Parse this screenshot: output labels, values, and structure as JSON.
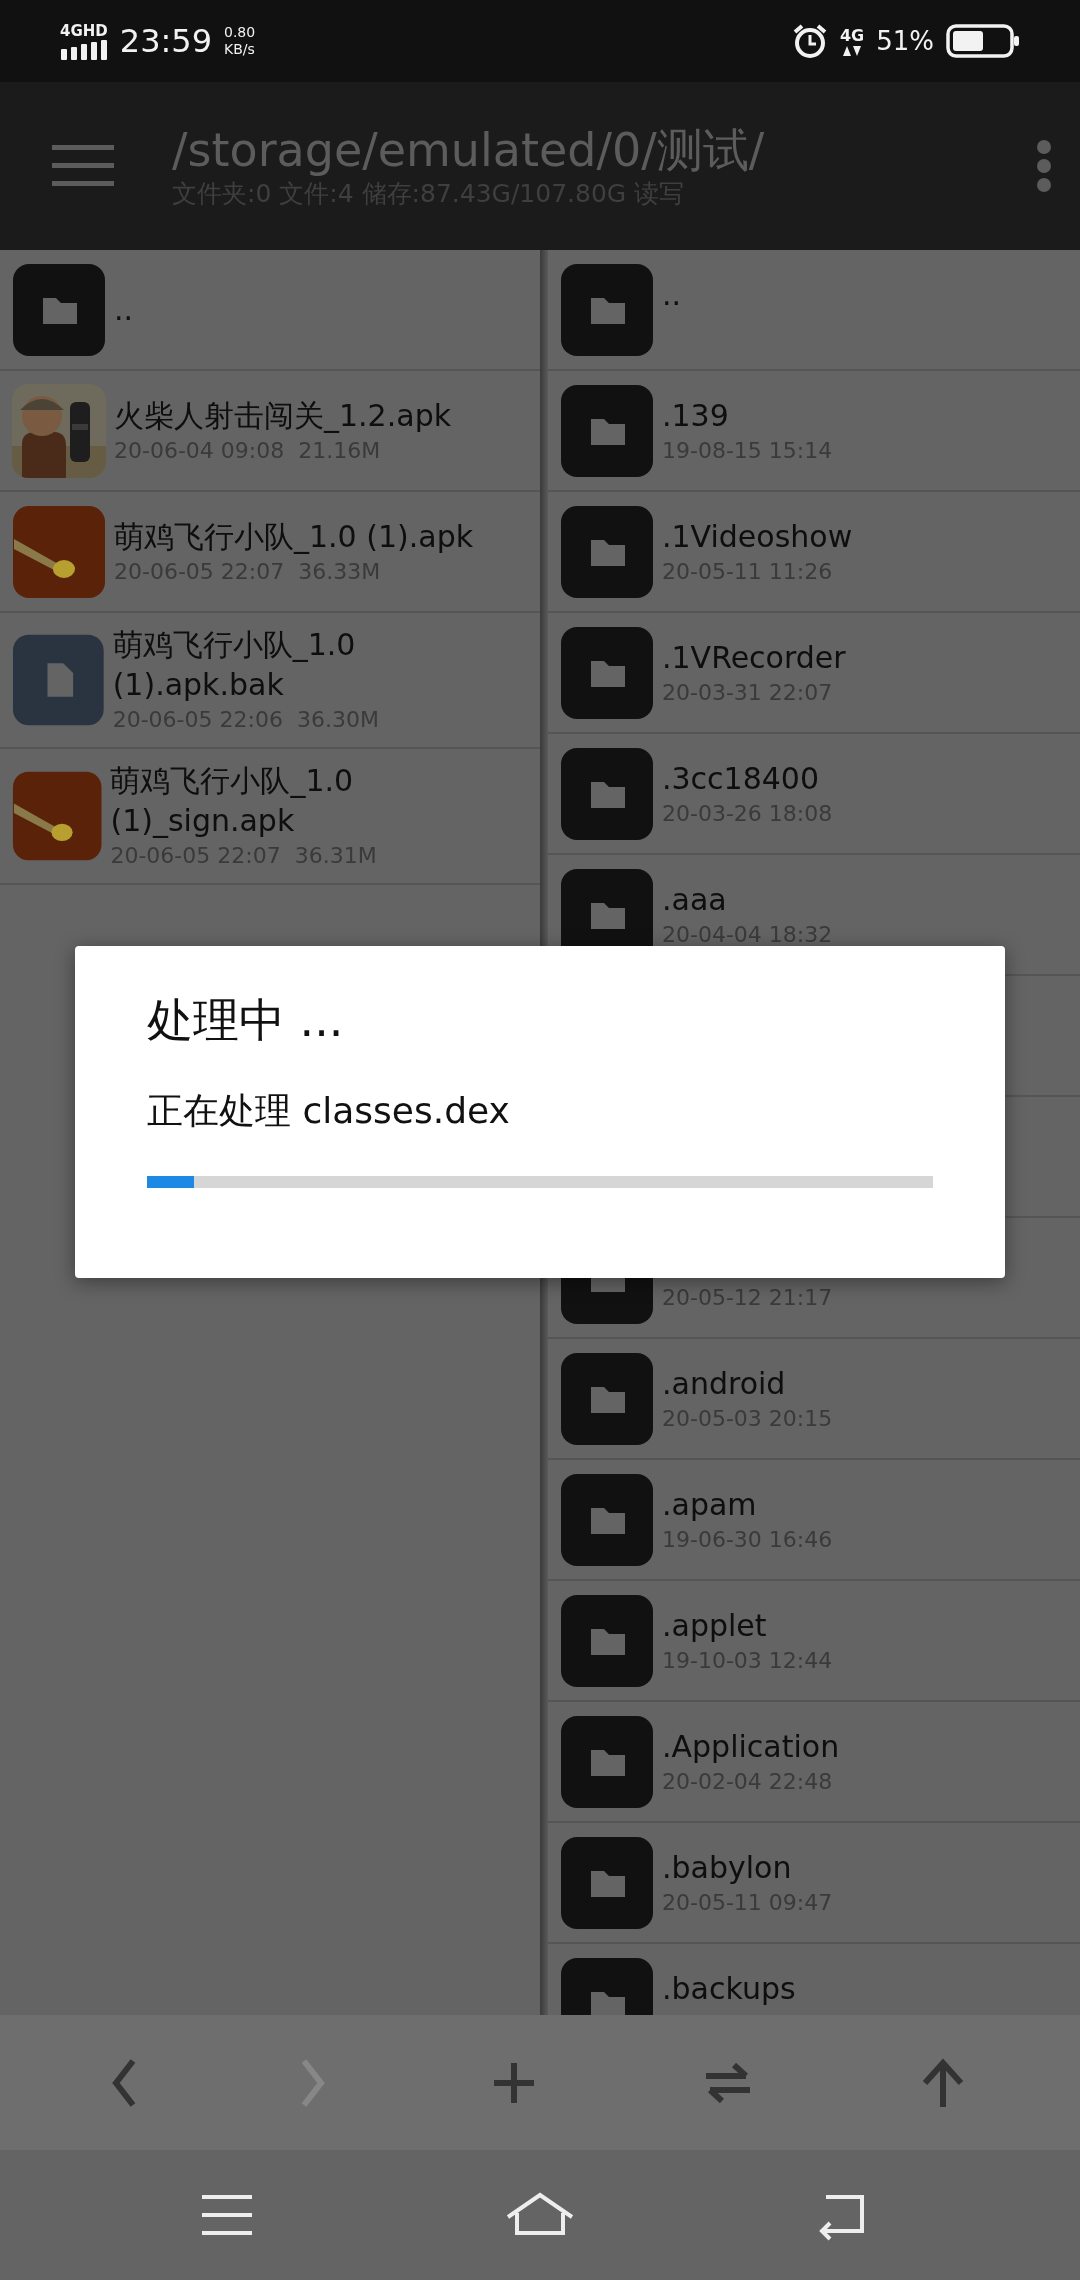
{
  "status_bar": {
    "network": "4GHD",
    "time": "23:59",
    "speed": "0.80",
    "speed_unit": "KB/s",
    "mobile": "4G",
    "battery": "51%"
  },
  "header": {
    "path": "/storage/emulated/0/测试/",
    "info": "文件夹:0 文件:4 储存:87.43G/107.80G 读写"
  },
  "left_pane": {
    "items": [
      {
        "kind": "folder",
        "name": ".."
      },
      {
        "kind": "game",
        "name": "火柴人射击闯关_1.2.apk",
        "date": "20-06-04 09:08",
        "size": "21.16M"
      },
      {
        "kind": "bird",
        "name": "萌鸡飞行小队_1.0 (1).apk",
        "date": "20-06-05 22:07",
        "size": "36.33M"
      },
      {
        "kind": "file",
        "name": "萌鸡飞行小队_1.0 (1).apk.bak",
        "date": "20-06-05 22:06",
        "size": "36.30M"
      },
      {
        "kind": "bird",
        "name": "萌鸡飞行小队_1.0 (1)_sign.apk",
        "date": "20-06-05 22:07",
        "size": "36.31M"
      }
    ]
  },
  "right_pane": {
    "items": [
      {
        "kind": "folder",
        "name": ".."
      },
      {
        "kind": "folder",
        "name": ".139",
        "date": "19-08-15 15:14"
      },
      {
        "kind": "folder",
        "name": ".1Videoshow",
        "date": "20-05-11 11:26"
      },
      {
        "kind": "folder",
        "name": ".1VRecorder",
        "date": "20-03-31 22:07"
      },
      {
        "kind": "folder",
        "name": ".3cc18400",
        "date": "20-03-26 18:08"
      },
      {
        "kind": "folder",
        "name": ".aaa",
        "date": "20-04-04 18:32"
      },
      {
        "kind": "covered"
      },
      {
        "kind": "covered"
      },
      {
        "kind": "folder",
        "date": "20-05-12 21:17"
      },
      {
        "kind": "folder",
        "name": ".android",
        "date": "20-05-03 20:15"
      },
      {
        "kind": "folder",
        "name": ".apam",
        "date": "19-06-30 16:46"
      },
      {
        "kind": "folder",
        "name": ".applet",
        "date": "19-10-03 12:44"
      },
      {
        "kind": "folder",
        "name": ".Application",
        "date": "20-02-04 22:48"
      },
      {
        "kind": "folder",
        "name": ".babylon",
        "date": "20-05-11 09:47"
      },
      {
        "kind": "folder",
        "name": ".backups"
      }
    ]
  },
  "toolbar": {
    "buttons": [
      {
        "kind": "back",
        "disabled": false
      },
      {
        "kind": "forward",
        "disabled": true
      },
      {
        "kind": "add",
        "disabled": false
      },
      {
        "kind": "swap",
        "disabled": false
      },
      {
        "kind": "up",
        "disabled": false
      }
    ]
  },
  "dialog": {
    "title": "处理中 ...",
    "message": "正在处理 classes.dex",
    "level": 0.06
  },
  "nav_bar": {
    "buttons": [
      {
        "kind": "menu"
      },
      {
        "kind": "home"
      },
      {
        "kind": "back"
      }
    ]
  }
}
